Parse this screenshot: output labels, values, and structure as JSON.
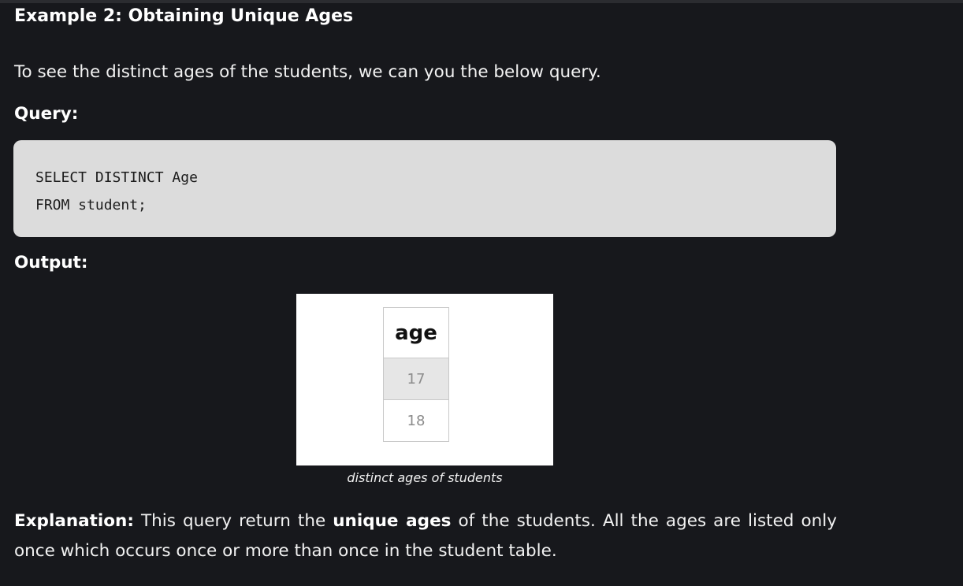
{
  "heading": "Example 2: Obtaining Unique Ages",
  "intro": "To see the distinct ages of the students, we can you the below query.",
  "query_label": "Query:",
  "code_lines": [
    "SELECT DISTINCT Age",
    "FROM student;"
  ],
  "output_label": "Output:",
  "result_table": {
    "header": "age",
    "rows": [
      "17",
      "18"
    ]
  },
  "figure_caption": "distinct ages of students",
  "explanation": {
    "label": "Explanation:",
    "text_before": "This query return the",
    "emphasis": "unique ages",
    "text_after": "of the students. All the ages are listed only once which occurs once or more than once in the student table."
  }
}
